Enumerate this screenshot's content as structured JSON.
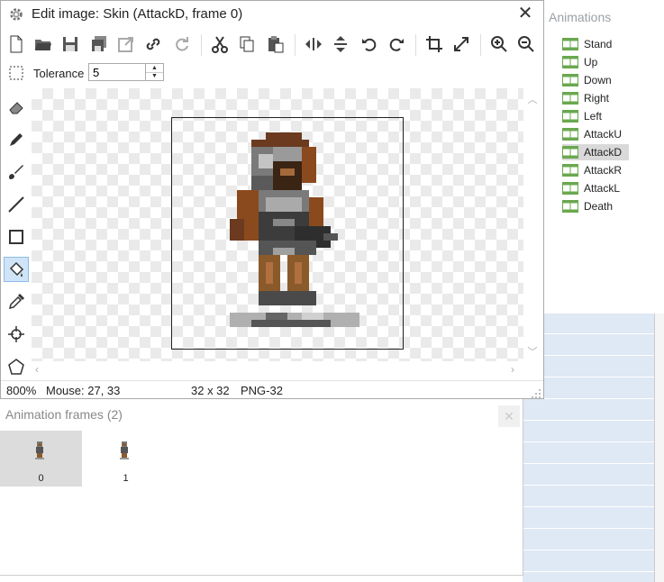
{
  "editor": {
    "title": "Edit image: Skin (AttackD, frame 0)",
    "tolerance_label": "Tolerance",
    "tolerance_value": "5",
    "toolbar_icons": [
      "new-icon",
      "open-icon",
      "save-icon",
      "save-all-icon",
      "export-icon",
      "link-icon",
      "refresh-icon",
      "cut-icon",
      "copy-icon",
      "paste-icon",
      "flip-horizontal-icon",
      "flip-vertical-icon",
      "rotate-left-icon",
      "rotate-right-icon",
      "crop-icon",
      "resize-icon",
      "zoom-in-icon",
      "zoom-out-icon"
    ],
    "left_tools": [
      "select-icon",
      "eraser-icon",
      "pencil-icon",
      "brush-icon",
      "line-icon",
      "rectangle-icon",
      "fill-bucket-icon",
      "eyedropper-icon",
      "crosshair-icon",
      "polygon-icon"
    ],
    "active_tool": "fill-bucket-icon",
    "status": {
      "zoom": "800%",
      "mouse": "Mouse: 27, 33",
      "size": "32 x 32",
      "format": "PNG-32"
    }
  },
  "animations": {
    "title": "Animations",
    "items": [
      "Stand",
      "Up",
      "Down",
      "Right",
      "Left",
      "AttackU",
      "AttackD",
      "AttackR",
      "AttackL",
      "Death"
    ],
    "selected": "AttackD"
  },
  "frames": {
    "title": "Animation frames (2)",
    "items": [
      {
        "label": "0",
        "selected": true
      },
      {
        "label": "1",
        "selected": false
      }
    ]
  },
  "colors": {
    "accent_selected": "#cfe4f7",
    "film_green": "#6aa84f",
    "checker": "#eaeaea"
  }
}
